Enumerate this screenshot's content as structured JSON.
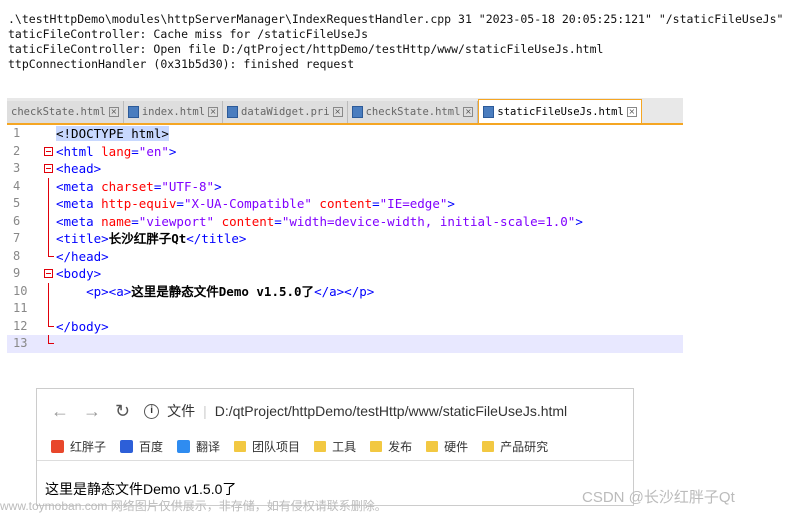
{
  "log": [
    ".\\testHttpDemo\\modules\\httpServerManager\\IndexRequestHandler.cpp 31 \"2023-05-18 20:05:25:121\" \"/staticFileUseJs\"",
    "taticFileController: Cache miss for /staticFileUseJs",
    "taticFileController: Open file D:/qtProject/httpDemo/testHttp/www/staticFileUseJs.html",
    "ttpConnectionHandler (0x31b5d30): finished request"
  ],
  "tabs": [
    {
      "label": "checkState.html",
      "active": false
    },
    {
      "label": "index.html",
      "active": false
    },
    {
      "label": "dataWidget.pri",
      "active": false
    },
    {
      "label": "checkState.html",
      "active": false
    },
    {
      "label": "staticFileUseJs.html",
      "active": true
    }
  ],
  "code": [
    {
      "n": "1",
      "fold": "",
      "parts": [
        [
          "doc",
          "<!DOCTYPE html>"
        ]
      ]
    },
    {
      "n": "2",
      "fold": "box",
      "parts": [
        [
          "tag",
          "<html "
        ],
        [
          "attr",
          "lang"
        ],
        [
          "tag",
          "="
        ],
        [
          "val",
          "\"en\""
        ],
        [
          "tag",
          ">"
        ]
      ]
    },
    {
      "n": "3",
      "fold": "box",
      "parts": [
        [
          "tag",
          "<head>"
        ]
      ]
    },
    {
      "n": "4",
      "fold": "line",
      "parts": [
        [
          "tag",
          "<meta "
        ],
        [
          "attr",
          "charset"
        ],
        [
          "tag",
          "="
        ],
        [
          "val",
          "\"UTF-8\""
        ],
        [
          "tag",
          ">"
        ]
      ]
    },
    {
      "n": "5",
      "fold": "line",
      "parts": [
        [
          "tag",
          "<meta "
        ],
        [
          "attr",
          "http-equiv"
        ],
        [
          "tag",
          "="
        ],
        [
          "val",
          "\"X-UA-Compatible\""
        ],
        [
          "tag",
          " "
        ],
        [
          "attr",
          "content"
        ],
        [
          "tag",
          "="
        ],
        [
          "val",
          "\"IE=edge\""
        ],
        [
          "tag",
          ">"
        ]
      ]
    },
    {
      "n": "6",
      "fold": "line",
      "parts": [
        [
          "tag",
          "<meta "
        ],
        [
          "attr",
          "name"
        ],
        [
          "tag",
          "="
        ],
        [
          "val",
          "\"viewport\""
        ],
        [
          "tag",
          " "
        ],
        [
          "attr",
          "content"
        ],
        [
          "tag",
          "="
        ],
        [
          "val",
          "\"width=device-width, initial-scale=1.0\""
        ],
        [
          "tag",
          ">"
        ]
      ]
    },
    {
      "n": "7",
      "fold": "line",
      "parts": [
        [
          "tag",
          "<title>"
        ],
        [
          "txt",
          "长沙红胖子Qt"
        ],
        [
          "tag",
          "</title>"
        ]
      ]
    },
    {
      "n": "8",
      "fold": "end",
      "parts": [
        [
          "tag",
          "</head>"
        ]
      ]
    },
    {
      "n": "9",
      "fold": "box",
      "parts": [
        [
          "tag",
          "<body>"
        ]
      ]
    },
    {
      "n": "10",
      "fold": "line",
      "parts": [
        [
          "tag",
          "    <p><a>"
        ],
        [
          "txt",
          "这里是静态文件Demo v1.5.0了"
        ],
        [
          "tag",
          "</a></p>"
        ]
      ]
    },
    {
      "n": "11",
      "fold": "line",
      "parts": []
    },
    {
      "n": "12",
      "fold": "end",
      "parts": [
        [
          "tag",
          "</body>"
        ]
      ]
    },
    {
      "n": "13",
      "fold": "end",
      "parts": [],
      "current": true
    }
  ],
  "browser": {
    "file_label": "文件",
    "url": "D:/qtProject/httpDemo/testHttp/www/staticFileUseJs.html",
    "bookmarks": [
      {
        "label": "红胖子",
        "icon": "c-icon",
        "color": "#e8472b"
      },
      {
        "label": "百度",
        "icon": "baidu-icon",
        "color": "#2d5fd8"
      },
      {
        "label": "翻译",
        "icon": "translate-icon",
        "color": "#2f8cf0"
      },
      {
        "label": "团队项目",
        "icon": "folder-icon"
      },
      {
        "label": "工具",
        "icon": "folder-icon"
      },
      {
        "label": "发布",
        "icon": "folder-icon"
      },
      {
        "label": "硬件",
        "icon": "folder-icon"
      },
      {
        "label": "产品研究",
        "icon": "folder-icon"
      }
    ],
    "body_text": "这里是静态文件Demo v1.5.0了"
  },
  "watermark": "www.toymoban.com 网络图片仅供展示，非存储，如有侵权请联系删除。",
  "csdn": "CSDN @长沙红胖子Qt"
}
